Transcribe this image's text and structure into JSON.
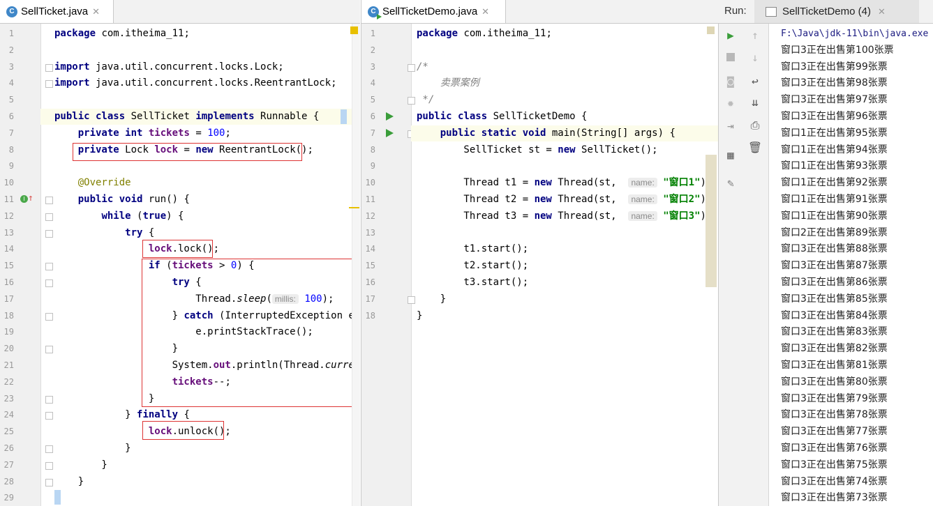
{
  "left_editor": {
    "tab": {
      "label": "SellTicket.java",
      "icon": "class-file-icon"
    },
    "lines": [
      [
        [
          "kw",
          "package"
        ],
        [
          "t",
          " com.itheima_11;"
        ]
      ],
      [],
      [
        [
          "kw",
          "import"
        ],
        [
          "t",
          " java.util.concurrent.locks.Lock;"
        ]
      ],
      [
        [
          "kw",
          "import"
        ],
        [
          "t",
          " java.util.concurrent.locks.ReentrantLock;"
        ]
      ],
      [],
      [
        [
          "kw",
          "public class"
        ],
        [
          "t",
          " SellTicket "
        ],
        [
          "kw",
          "implements"
        ],
        [
          "t",
          " Runnable {"
        ]
      ],
      [
        [
          "t",
          "    "
        ],
        [
          "kw",
          "private int"
        ],
        [
          "t",
          " "
        ],
        [
          "fld",
          "tickets"
        ],
        [
          "t",
          " = "
        ],
        [
          "num",
          "100"
        ],
        [
          "t",
          ";"
        ]
      ],
      [
        [
          "t",
          "    "
        ],
        [
          "kw",
          "private"
        ],
        [
          "t",
          " Lock "
        ],
        [
          "fld",
          "lock"
        ],
        [
          "t",
          " = "
        ],
        [
          "kw",
          "new"
        ],
        [
          "t",
          " ReentrantLock();"
        ]
      ],
      [],
      [
        [
          "t",
          "    "
        ],
        [
          "ann",
          "@Override"
        ]
      ],
      [
        [
          "t",
          "    "
        ],
        [
          "kw",
          "public void"
        ],
        [
          "t",
          " run() {"
        ]
      ],
      [
        [
          "t",
          "        "
        ],
        [
          "kw",
          "while"
        ],
        [
          "t",
          " ("
        ],
        [
          "kw",
          "true"
        ],
        [
          "t",
          ") {"
        ]
      ],
      [
        [
          "t",
          "            "
        ],
        [
          "kw",
          "try"
        ],
        [
          "t",
          " {"
        ]
      ],
      [
        [
          "t",
          "                "
        ],
        [
          "fld",
          "lock"
        ],
        [
          "t",
          ".lock();"
        ]
      ],
      [
        [
          "t",
          "                "
        ],
        [
          "kw",
          "if"
        ],
        [
          "t",
          " ("
        ],
        [
          "fld",
          "tickets"
        ],
        [
          "t",
          " > "
        ],
        [
          "num",
          "0"
        ],
        [
          "t",
          ") {"
        ]
      ],
      [
        [
          "t",
          "                    "
        ],
        [
          "kw",
          "try"
        ],
        [
          "t",
          " {"
        ]
      ],
      [
        [
          "t",
          "                        Thread."
        ],
        [
          "it",
          "sleep"
        ],
        [
          "t",
          "("
        ],
        [
          "hint",
          "millis:"
        ],
        [
          "t",
          " "
        ],
        [
          "num",
          "100"
        ],
        [
          "t",
          ");"
        ]
      ],
      [
        [
          "t",
          "                    } "
        ],
        [
          "kw",
          "catch"
        ],
        [
          "t",
          " (InterruptedException e) {"
        ]
      ],
      [
        [
          "t",
          "                        e.printStackTrace();"
        ]
      ],
      [
        [
          "t",
          "                    }"
        ]
      ],
      [
        [
          "t",
          "                    System."
        ],
        [
          "fld",
          "out"
        ],
        [
          "t",
          ".println(Thread."
        ],
        [
          "it",
          "currentTh"
        ]
      ],
      [
        [
          "t",
          "                    "
        ],
        [
          "fld",
          "tickets"
        ],
        [
          "t",
          "--;"
        ]
      ],
      [
        [
          "t",
          "                }"
        ]
      ],
      [
        [
          "t",
          "            } "
        ],
        [
          "kw",
          "finally"
        ],
        [
          "t",
          " {"
        ]
      ],
      [
        [
          "t",
          "                "
        ],
        [
          "fld",
          "lock"
        ],
        [
          "t",
          ".unlock();"
        ]
      ],
      [
        [
          "t",
          "            }"
        ]
      ],
      [
        [
          "t",
          "        }"
        ]
      ],
      [
        [
          "t",
          "    }"
        ]
      ],
      [
        [
          "t",
          "}"
        ]
      ]
    ]
  },
  "right_editor": {
    "tab": {
      "label": "SellTicketDemo.java",
      "icon": "runnable-class-file-icon"
    },
    "lines": [
      [
        [
          "kw",
          "package"
        ],
        [
          "t",
          " com.itheima_11;"
        ]
      ],
      [],
      [
        [
          "cmt",
          "/*"
        ]
      ],
      [
        [
          "cmt",
          "    卖票案例"
        ]
      ],
      [
        [
          "cmt",
          " */"
        ]
      ],
      [
        [
          "kw",
          "public class"
        ],
        [
          "t",
          " SellTicketDemo {"
        ]
      ],
      [
        [
          "t",
          "    "
        ],
        [
          "kw",
          "public static void"
        ],
        [
          "t",
          " main(String[] args) {"
        ]
      ],
      [
        [
          "t",
          "        SellTicket st = "
        ],
        [
          "kw",
          "new"
        ],
        [
          "t",
          " SellTicket();"
        ]
      ],
      [],
      [
        [
          "t",
          "        Thread t1 = "
        ],
        [
          "kw",
          "new"
        ],
        [
          "t",
          " Thread(st,  "
        ],
        [
          "hint",
          "name:"
        ],
        [
          "t",
          " "
        ],
        [
          "str",
          "\"窗口1\""
        ],
        [
          "t",
          ");"
        ]
      ],
      [
        [
          "t",
          "        Thread t2 = "
        ],
        [
          "kw",
          "new"
        ],
        [
          "t",
          " Thread(st,  "
        ],
        [
          "hint",
          "name:"
        ],
        [
          "t",
          " "
        ],
        [
          "str",
          "\"窗口2\""
        ],
        [
          "t",
          ");"
        ]
      ],
      [
        [
          "t",
          "        Thread t3 = "
        ],
        [
          "kw",
          "new"
        ],
        [
          "t",
          " Thread(st,  "
        ],
        [
          "hint",
          "name:"
        ],
        [
          "t",
          " "
        ],
        [
          "str",
          "\"窗口3\""
        ],
        [
          "t",
          ");"
        ]
      ],
      [],
      [
        [
          "t",
          "        t1.start();"
        ]
      ],
      [
        [
          "t",
          "        t2.start();"
        ]
      ],
      [
        [
          "t",
          "        t3.start();"
        ]
      ],
      [
        [
          "t",
          "    }"
        ]
      ],
      [
        [
          "t",
          "}"
        ]
      ]
    ]
  },
  "run_panel": {
    "label": "Run:",
    "tab_label": "SellTicketDemo (4)",
    "console": [
      "F:\\Java\\jdk-11\\bin\\java.exe",
      "窗口3正在出售第100张票",
      "窗口3正在出售第99张票",
      "窗口3正在出售第98张票",
      "窗口3正在出售第97张票",
      "窗口3正在出售第96张票",
      "窗口1正在出售第95张票",
      "窗口1正在出售第94张票",
      "窗口1正在出售第93张票",
      "窗口1正在出售第92张票",
      "窗口1正在出售第91张票",
      "窗口1正在出售第90张票",
      "窗口2正在出售第89张票",
      "窗口3正在出售第88张票",
      "窗口3正在出售第87张票",
      "窗口3正在出售第86张票",
      "窗口3正在出售第85张票",
      "窗口3正在出售第84张票",
      "窗口3正在出售第83张票",
      "窗口3正在出售第82张票",
      "窗口3正在出售第81张票",
      "窗口3正在出售第80张票",
      "窗口3正在出售第79张票",
      "窗口3正在出售第78张票",
      "窗口3正在出售第77张票",
      "窗口3正在出售第76张票",
      "窗口3正在出售第75张票",
      "窗口3正在出售第74张票",
      "窗口3正在出售第73张票"
    ],
    "tools_left": [
      "run-icon",
      "stop-icon",
      "camera-icon",
      "debug-icon",
      "exit-icon",
      "layout-icon",
      "pin-icon"
    ],
    "tools_right": [
      "up-arrow-icon",
      "down-arrow-icon",
      "soft-wrap-icon",
      "scroll-to-end-icon",
      "print-icon",
      "trash-icon"
    ]
  },
  "colors": {
    "keyword": "#000080",
    "field": "#660e7a",
    "number": "#0000ff",
    "string": "#008000",
    "highlight_box": "#dd3333",
    "run_green": "#3a9d3a"
  }
}
